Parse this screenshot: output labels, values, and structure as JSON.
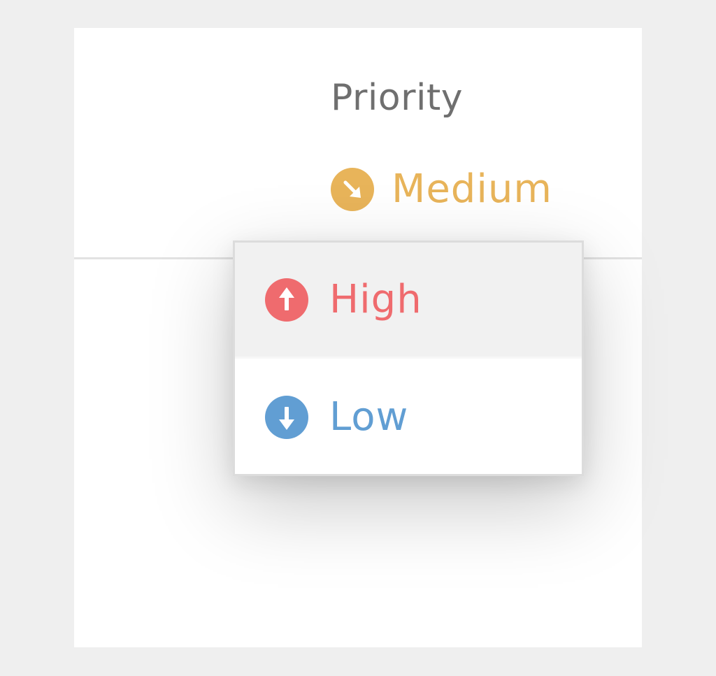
{
  "column_header": "Priority",
  "selected": {
    "label": "Medium",
    "icon": "arrow-down-right-circle-icon",
    "color": "#e8b45a"
  },
  "options": [
    {
      "label": "High",
      "icon": "arrow-up-circle-icon",
      "color": "#ef6b6e",
      "highlighted": true
    },
    {
      "label": "Low",
      "icon": "arrow-down-circle-icon",
      "color": "#619ed3",
      "highlighted": false
    }
  ]
}
